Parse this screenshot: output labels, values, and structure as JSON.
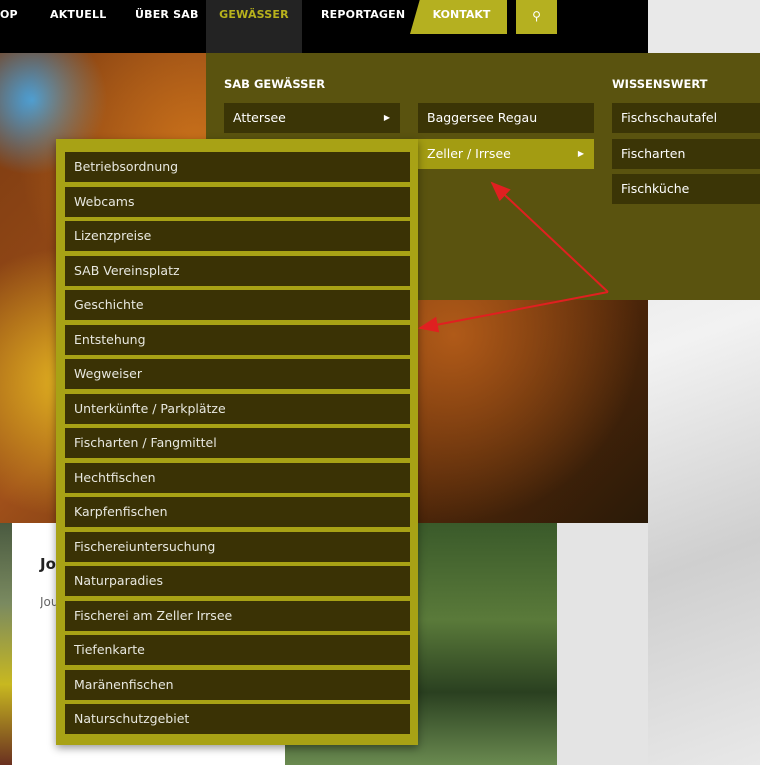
{
  "nav": {
    "items": [
      "OP",
      "AKTUELL",
      "ÜBER SAB",
      "GEWÄSSER",
      "REPORTAGEN"
    ],
    "active": "GEWÄSSER",
    "kontakt": "KONTAKT",
    "search_icon": "search-icon"
  },
  "mega": {
    "col1": {
      "heading": "SAB GEWÄSSER",
      "items": [
        "Attersee"
      ]
    },
    "col2": {
      "items": [
        "Baggersee Regau",
        "Zeller / Irrsee"
      ]
    },
    "col3": {
      "heading": "WISSENSWERT",
      "items": [
        "Fischschautafel",
        "Fischarten",
        "Fischküche"
      ]
    }
  },
  "submenu": [
    "Betriebsordnung",
    "Webcams",
    "Lizenzpreise",
    "SAB Vereinsplatz",
    "Geschichte",
    "Entstehung",
    "Wegweiser",
    "Unterkünfte / Parkplätze",
    "Fischarten / Fangmittel",
    "Hechtfischen",
    "Karpfenfischen",
    "Fischereiuntersuchung",
    "Naturparadies",
    "Fischerei am Zeller Irrsee",
    "Tiefenkarte",
    "Maränenfischen",
    "Naturschutzgebiet"
  ],
  "card": {
    "title": "Jo",
    "text": "Jou on"
  },
  "colors": {
    "accent": "#b5b020",
    "mega_bg": "#5a530f",
    "item_bg": "#3b3506",
    "arrow": "#e02020"
  }
}
